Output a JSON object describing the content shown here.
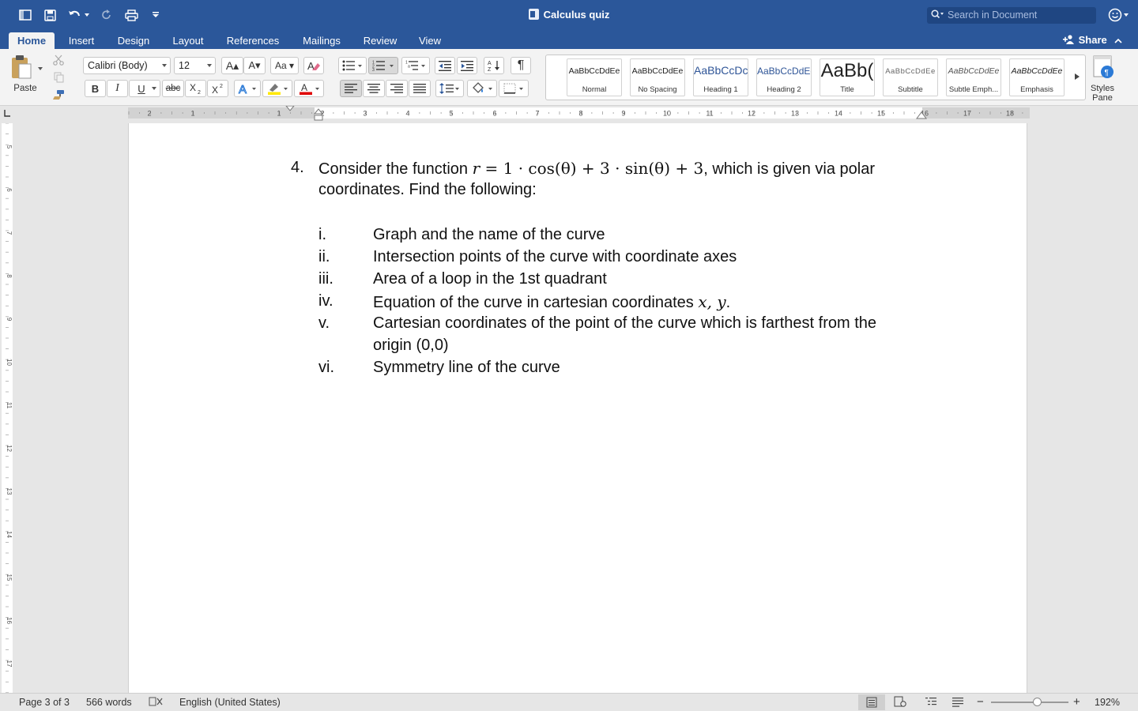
{
  "app": {
    "title": "Calculus quiz",
    "search_placeholder": "Search in Document"
  },
  "tabs": [
    {
      "label": "Home",
      "active": true
    },
    {
      "label": "Insert"
    },
    {
      "label": "Design"
    },
    {
      "label": "Layout"
    },
    {
      "label": "References"
    },
    {
      "label": "Mailings"
    },
    {
      "label": "Review"
    },
    {
      "label": "View"
    }
  ],
  "share_label": "Share",
  "ribbon": {
    "paste_label": "Paste",
    "font_name": "Calibri (Body)",
    "font_size": "12",
    "bold": "B",
    "italic": "I",
    "underline": "U",
    "strike": "abc",
    "pilcrow": "¶",
    "styles": [
      {
        "sample": "AaBbCcDdEe",
        "name": "Normal"
      },
      {
        "sample": "AaBbCcDdEe",
        "name": "No Spacing"
      },
      {
        "sample": "AaBbCcDc",
        "name": "Heading 1"
      },
      {
        "sample": "AaBbCcDdEe",
        "name": "Heading 2"
      },
      {
        "sample": "AaBb(",
        "name": "Title"
      },
      {
        "sample": "AaBbCcDdEe",
        "name": "Subtitle"
      },
      {
        "sample": "AaBbCcDdEe",
        "name": "Subtle Emph..."
      },
      {
        "sample": "AaBbCcDdEe",
        "name": "Emphasis"
      }
    ],
    "styles_pane_line1": "Styles",
    "styles_pane_line2": "Pane"
  },
  "ruler": {
    "h_labels": [
      "2",
      "1",
      "1",
      "2",
      "3",
      "4",
      "5",
      "6",
      "7",
      "8",
      "9",
      "10",
      "11",
      "12",
      "13",
      "14",
      "15",
      "16",
      "17",
      "18"
    ],
    "v_labels": [
      "5",
      "6",
      "7",
      "8",
      "9",
      "10",
      "11",
      "12",
      "13",
      "14",
      "15",
      "16",
      "17"
    ]
  },
  "document": {
    "question_number": "4.",
    "line1_pre": "Consider the function",
    "formula_r": "r",
    "formula_rest": " = 1  · cos(θ) + 3 · sin(θ) + 3",
    "line1_post": ", which is given via polar",
    "line2": "coordinates. Find the following:",
    "items": [
      {
        "num": "i.",
        "text": "Graph and the name of the curve"
      },
      {
        "num": "ii.",
        "text": "Intersection points of the curve with coordinate axes"
      },
      {
        "num": "iii.",
        "text": "Area of a loop in the 1st quadrant"
      },
      {
        "num": "iv.",
        "text": "Equation of the curve in cartesian coordinates ",
        "math": "x, y",
        "tail": "."
      },
      {
        "num": "v.",
        "text": "Cartesian coordinates of the point of the curve which is farthest from the",
        "cont": "origin (0,0)"
      },
      {
        "num": "vi.",
        "text": "Symmetry line of the curve"
      }
    ]
  },
  "status": {
    "page": "Page 3 of 3",
    "words": "566 words",
    "language": "English (United States)",
    "zoom": "192%"
  },
  "colors": {
    "accent": "#2b579a",
    "ribbon_bg": "#f3f3f3",
    "canvas_bg": "#e6e6e6"
  }
}
